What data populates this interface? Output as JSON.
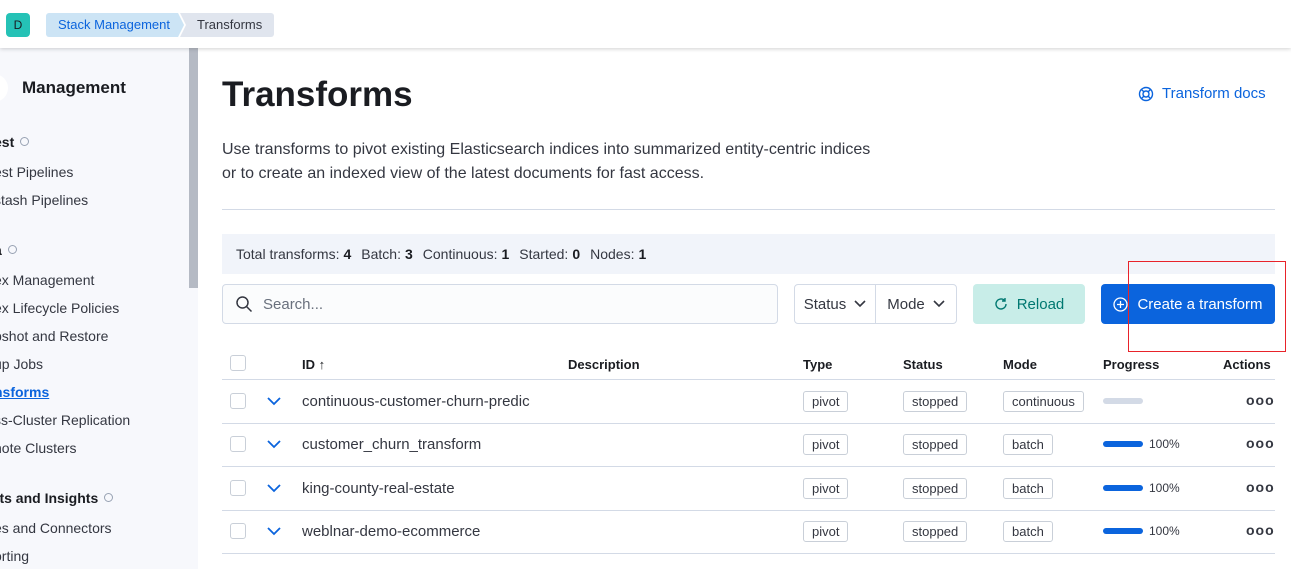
{
  "header": {
    "avatar_letter": "D",
    "breadcrumbs": [
      "Stack Management",
      "Transforms"
    ]
  },
  "sidebar": {
    "title": "Management",
    "groups": [
      {
        "label": "est",
        "items": [
          {
            "label": "est Pipelines"
          },
          {
            "label": "stash Pipelines"
          }
        ]
      },
      {
        "label": "a",
        "items": [
          {
            "label": "ex Management"
          },
          {
            "label": "ex Lifecycle Policies"
          },
          {
            "label": "pshot and Restore"
          },
          {
            "label": "up Jobs"
          },
          {
            "label": "nsforms"
          },
          {
            "label": "ss-Cluster Replication"
          },
          {
            "label": "note Clusters"
          }
        ]
      },
      {
        "label": "rts and Insights",
        "items": [
          {
            "label": "es and Connectors"
          },
          {
            "label": "orting"
          }
        ]
      }
    ]
  },
  "main": {
    "title": "Transforms",
    "docs_link": "Transform docs",
    "description": "Use transforms to pivot existing Elasticsearch indices into summarized entity-centric indices or to create an indexed view of the latest documents for fast access.",
    "stats": [
      {
        "label": "Total transforms:",
        "value": "4"
      },
      {
        "label": "Batch:",
        "value": "3"
      },
      {
        "label": "Continuous:",
        "value": "1"
      },
      {
        "label": "Started:",
        "value": "0"
      },
      {
        "label": "Nodes:",
        "value": "1"
      }
    ],
    "search_placeholder": "Search...",
    "filters": [
      "Status",
      "Mode"
    ],
    "reload_label": "Reload",
    "create_label": "Create a transform",
    "accent_color": "#0b64dd",
    "highlight_color": "#e8232a"
  },
  "table": {
    "headers": {
      "id": "ID",
      "sort_arrow": "↑",
      "description": "Description",
      "type": "Type",
      "status": "Status",
      "mode": "Mode",
      "progress": "Progress",
      "actions": "Actions"
    },
    "rows": [
      {
        "id": "continuous-customer-churn-predic",
        "description": "",
        "type": "pivot",
        "status": "stopped",
        "mode": "continuous",
        "progress": 0,
        "progress_label": ""
      },
      {
        "id": "customer_churn_transform",
        "description": "",
        "type": "pivot",
        "status": "stopped",
        "mode": "batch",
        "progress": 100,
        "progress_label": "100%"
      },
      {
        "id": "king-county-real-estate",
        "description": "",
        "type": "pivot",
        "status": "stopped",
        "mode": "batch",
        "progress": 100,
        "progress_label": "100%"
      },
      {
        "id": "weblnar-demo-ecommerce",
        "description": "",
        "type": "pivot",
        "status": "stopped",
        "mode": "batch",
        "progress": 100,
        "progress_label": "100%"
      }
    ],
    "actions_glyph": "ooo"
  }
}
